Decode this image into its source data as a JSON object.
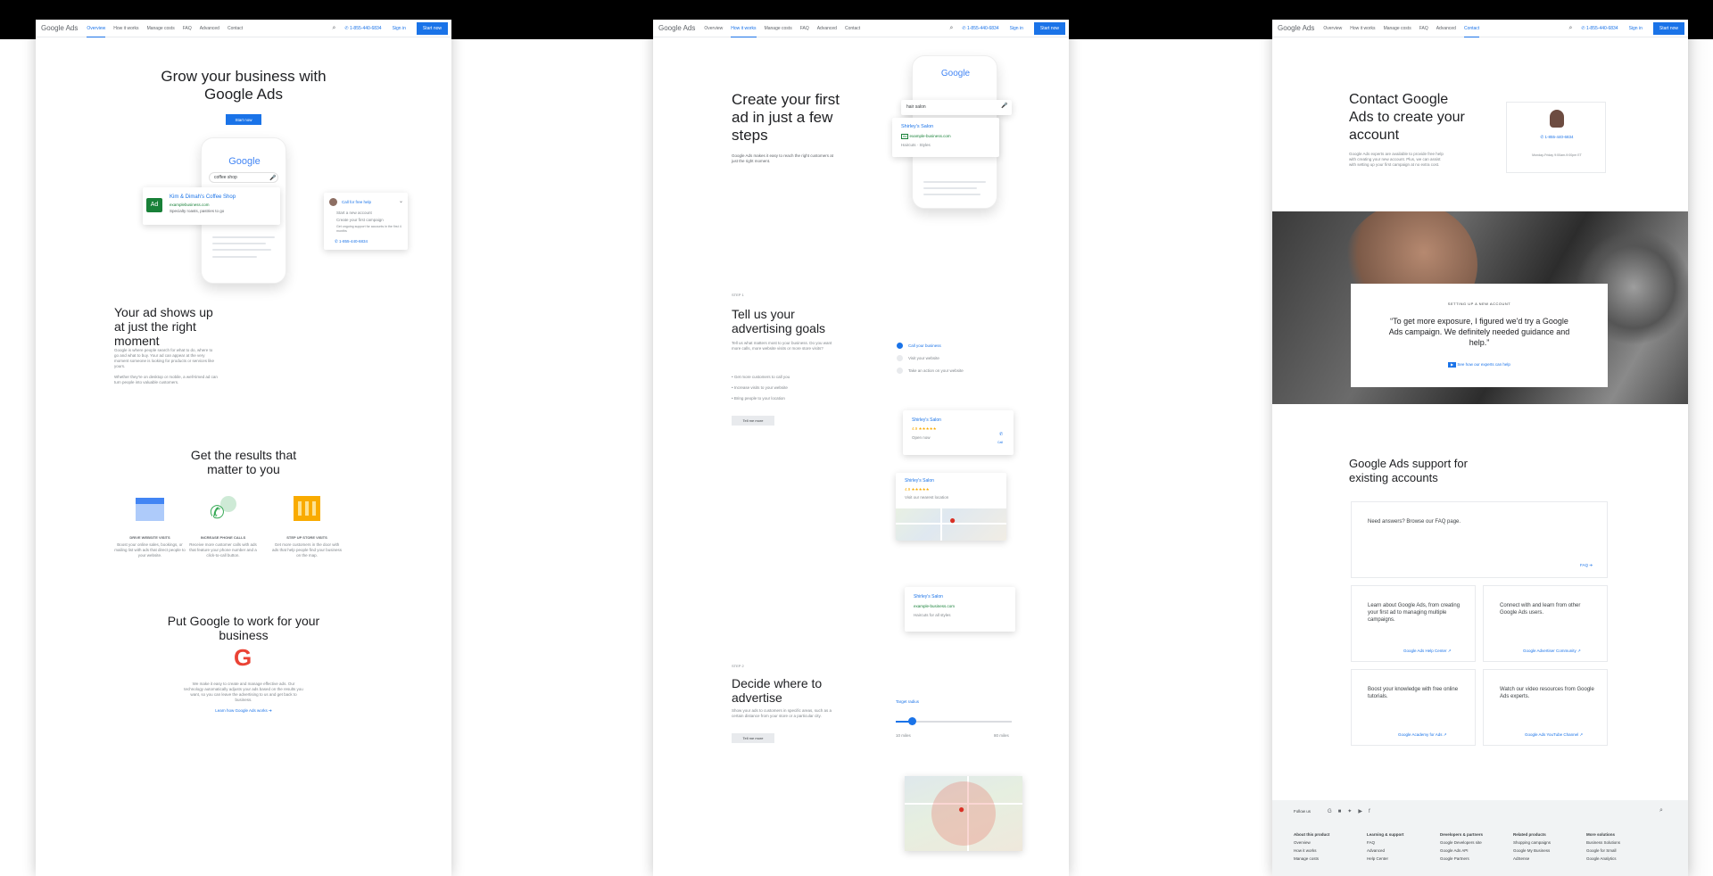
{
  "shared": {
    "logo": "Google Ads",
    "nav": [
      "Overview",
      "How it works",
      "Manage costs",
      "FAQ",
      "Advanced",
      "Contact"
    ],
    "phone": "1-855-440-6834",
    "sign_in": "Sign in",
    "start_now": "Start now"
  },
  "p1": {
    "hero_title": "Grow your business with Google Ads",
    "start_now": "Start now",
    "phone_logo": "Google",
    "search_text": "coffee shop",
    "ad_badge": "Ad",
    "ad_title": "Kim & Dimah's Coffee Shop",
    "ad_url": "examplebusiness.com",
    "ad_desc": "Specialty roasts, pastries to go",
    "help_title": "Call for free help",
    "help_items": [
      "Start a new account",
      "Create your first campaign",
      "Get ongoing support for accounts in the first 4 months"
    ],
    "help_phone": "1-855-440-6834",
    "moment_title": "Your ad shows up at just the right moment",
    "moment_p1": "Google is where people search for what to do, where to go and what to buy. Your ad can appear at the very moment someone is looking for products or services like yours.",
    "moment_p2": "Whether they're on desktop or mobile, a well-timed ad can turn people into valuable customers.",
    "results_title": "Get the results that matter to you",
    "results": [
      {
        "label": "DRIVE WEBSITE VISITS",
        "desc": "Boost your online sales, bookings, or mailing list with ads that direct people to your website."
      },
      {
        "label": "INCREASE PHONE CALLS",
        "desc": "Receive more customer calls with ads that feature your phone number and a click-to-call button."
      },
      {
        "label": "STEP UP STORE VISITS",
        "desc": "Get more customers in the door with ads that help people find your business on the map."
      }
    ],
    "work_title": "Put Google to work for your business",
    "work_desc": "We make it easy to create and manage effective ads. Our technology automatically adjusts your ads based on the results you want, so you can leave the advertising to us and get back to business.",
    "work_link": "Learn how Google Ads works"
  },
  "p2": {
    "title": "Create your first ad in just a few steps",
    "desc": "Google Ads makes it easy to reach the right customers at just the right moment.",
    "phone_logo": "Google",
    "search_text": "hair salon",
    "ad_title": "Shirley's Salon",
    "ad_url": "example-business.com",
    "ad_meta": "Haircuts · Styles",
    "step1": "STEP 1",
    "goals_title": "Tell us your advertising goals",
    "goals_desc": "Tell us what matters most to your business. Do you want more calls, more website visits or more store visits?",
    "goals_items": [
      "Get more customers to call you",
      "Increase visits to your website",
      "Bring people to your location"
    ],
    "goals_btn": "Tell me more",
    "options": [
      "Call your business",
      "Visit your website",
      "Take an action on your website"
    ],
    "c1_title": "Shirley's Salon",
    "c1_rating": "4.9 ★★★★★",
    "c1_meta": "Open now",
    "c1_call": "Call",
    "c2_title": "Shirley's Salon",
    "c2_rating": "4.9 ★★★★★",
    "c2_meta": "Visit our nearest location",
    "c3_title": "Shirley's Salon",
    "c3_url": "example-business.com",
    "c3_meta": "Haircuts for all styles",
    "step2": "STEP 2",
    "where_title": "Decide where to advertise",
    "where_desc": "Show your ads to customers in specific areas, such as a certain distance from your store or a particular city.",
    "where_btn": "Tell me more",
    "range_label": "Target radius",
    "range_min": "10 miles",
    "range_max": "80 miles"
  },
  "p3": {
    "title": "Contact Google Ads to create your account",
    "desc": "Google Ads experts are available to provide free help with creating your new account. Plus, we can assist with setting up your first campaign at no extra cost.",
    "contact_phone": "1-855-440-6834",
    "contact_hours": "Monday-Friday 9:00am-9:00pm ET",
    "quote_kicker": "SETTING UP A NEW ACCOUNT",
    "quote": "“To get more exposure, I figured we'd try a Google Ads campaign. We definitely needed guidance and help.”",
    "quote_link": "See how our experts can help",
    "support_title": "Google Ads support for existing accounts",
    "faq_text": "Need answers? Browse our FAQ page.",
    "faq_link": "FAQ",
    "tiles": [
      {
        "text": "Learn about Google Ads, from creating your first ad to managing multiple campaigns.",
        "link": "Google Ads Help Center"
      },
      {
        "text": "Connect with and learn from other Google Ads users.",
        "link": "Google Advertiser Community"
      },
      {
        "text": "Boost your knowledge with free online tutorials.",
        "link": "Google Academy for Ads"
      },
      {
        "text": "Watch our video resources from Google Ads experts.",
        "link": "Google Ads YouTube Channel"
      }
    ],
    "follow": "Follow us",
    "footer_cols": [
      {
        "h": "About this product",
        "items": [
          "Overview",
          "How it works",
          "Manage costs"
        ]
      },
      {
        "h": "Learning & support",
        "items": [
          "FAQ",
          "Advanced",
          "Help Center"
        ]
      },
      {
        "h": "Developers & partners",
        "items": [
          "Google Developers site",
          "Google Ads API",
          "Google Partners"
        ]
      },
      {
        "h": "Related products",
        "items": [
          "Shopping campaigns",
          "Google My Business",
          "AdSense"
        ]
      },
      {
        "h": "More solutions",
        "items": [
          "Business Solutions",
          "Google for Small",
          "Google Analytics"
        ]
      }
    ]
  },
  "colors": {
    "accent": "#1a73e8",
    "ad_green": "#188038",
    "yellow": "#f9ab00",
    "green_icon": "#34a853",
    "red_pin": "#d93025"
  }
}
